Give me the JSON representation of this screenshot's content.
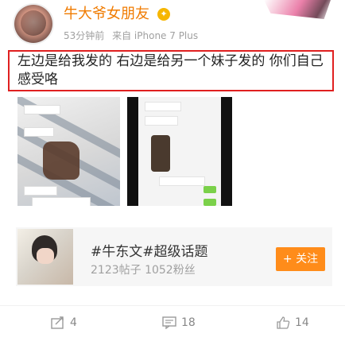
{
  "post": {
    "username": "牛大爷女朋友",
    "time": "53分钟前",
    "source": "来自 iPhone 7 Plus",
    "text": "左边是给我发的 右边是给另一个妹子发的 你们自己感受咯",
    "vip_badge": "✦"
  },
  "topic": {
    "title": "#牛东文#超级话题",
    "stats": "2123帖子 1052粉丝",
    "follow_label": "+ 关注"
  },
  "actions": {
    "repost_count": "4",
    "comment_count": "18",
    "like_count": "14"
  },
  "colors": {
    "username": "#f07b00",
    "highlight_border": "#e02020",
    "follow_button": "#ff8c1a"
  },
  "icons": [
    "avatar",
    "vip-icon",
    "repost-icon",
    "comment-icon",
    "like-icon"
  ]
}
